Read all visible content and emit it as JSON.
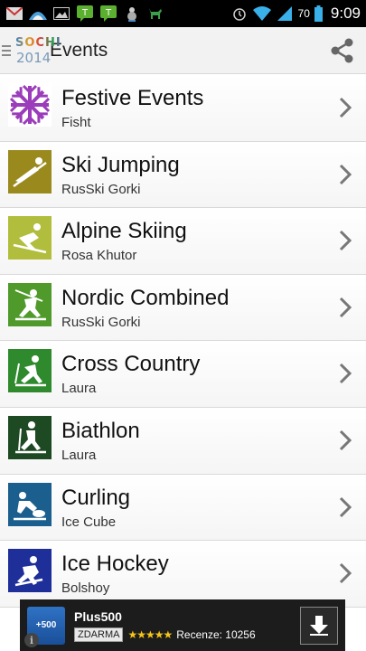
{
  "status_bar": {
    "battery_level": "70",
    "time": "9:09",
    "icons": [
      "gmail-icon",
      "weather-icon",
      "gallery-icon",
      "talk-icon",
      "talk-icon",
      "bug-icon",
      "deer-icon",
      "alarm-icon",
      "wifi-icon",
      "signal-icon",
      "battery-icon"
    ]
  },
  "action_bar": {
    "logo_top": "SOCHI",
    "logo_bottom": "2014",
    "title": "Events",
    "share_icon": "share-icon"
  },
  "events": [
    {
      "name": "Festive Events",
      "venue": "Fisht",
      "icon": "snowflake-icon",
      "icon_bg": "#ffffff",
      "icon_fg": "#9b3dba"
    },
    {
      "name": "Ski Jumping",
      "venue": "RusSki Gorki",
      "icon": "ski-jumping-icon",
      "icon_bg": "#9a8a1e",
      "icon_fg": "#ffffff"
    },
    {
      "name": "Alpine Skiing",
      "venue": "Rosa Khutor",
      "icon": "alpine-skiing-icon",
      "icon_bg": "#b1bd3c",
      "icon_fg": "#ffffff"
    },
    {
      "name": "Nordic Combined",
      "venue": "RusSki Gorki",
      "icon": "nordic-combined-icon",
      "icon_bg": "#4f9a2b",
      "icon_fg": "#ffffff"
    },
    {
      "name": "Cross Country",
      "venue": "Laura",
      "icon": "cross-country-icon",
      "icon_bg": "#2f8a2e",
      "icon_fg": "#ffffff"
    },
    {
      "name": "Biathlon",
      "venue": "Laura",
      "icon": "biathlon-icon",
      "icon_bg": "#1d4a22",
      "icon_fg": "#ffffff"
    },
    {
      "name": "Curling",
      "venue": "Ice Cube",
      "icon": "curling-icon",
      "icon_bg": "#1b5f8f",
      "icon_fg": "#ffffff"
    },
    {
      "name": "Ice Hockey",
      "venue": "Bolshoy",
      "icon": "ice-hockey-icon",
      "icon_bg": "#1f2f9a",
      "icon_fg": "#ffffff"
    }
  ],
  "ad": {
    "logo_text": "+500",
    "name": "Plus500",
    "badge": "ZDARMA",
    "stars": "★★★★★",
    "reviews": "Recenze: 10256",
    "info_glyph": "i"
  },
  "colors": {
    "chevron": "#777777",
    "divider": "#d9d9d9",
    "action_bar_bg": "#f2f2f2"
  }
}
